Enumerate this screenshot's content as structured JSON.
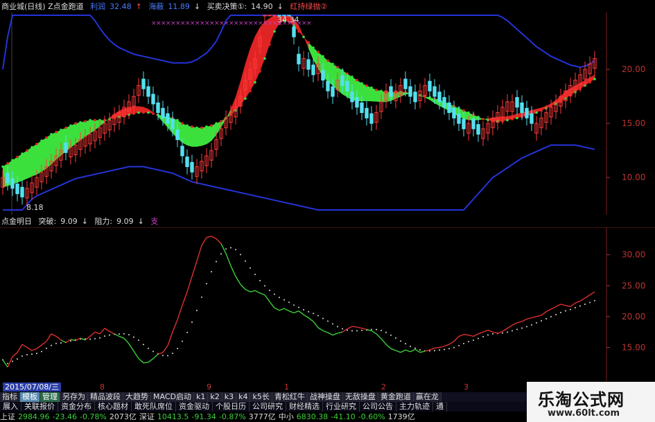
{
  "top_header": {
    "title": "商业城(日线) Z点金跑道",
    "profit_label": "利润",
    "profit_value": "32.48",
    "price_label": "海蔽",
    "price_value": "11.89",
    "signal_label": "买卖决策①:",
    "signal_value": "14.90",
    "redgreen_label": "红持绿抛②"
  },
  "bottom_header": {
    "title": "点金明日",
    "break_label": "突破:",
    "break_value": "9.09",
    "resist_label": "阻力:",
    "resist_value": "9.09",
    "tag": "支"
  },
  "annotations": {
    "high": "34.34",
    "low": "8.18"
  },
  "date_label": "2015/07/08/三",
  "tabs_row1": [
    {
      "label": "指标",
      "style": ""
    },
    {
      "label": "模板",
      "style": "active"
    },
    {
      "label": "管理",
      "style": "active2"
    },
    {
      "label": "另存为",
      "style": ""
    },
    {
      "label": "精品波段",
      "style": ""
    },
    {
      "label": "大趋势",
      "style": ""
    },
    {
      "label": "MACD启动",
      "style": ""
    },
    {
      "label": "k1",
      "style": ""
    },
    {
      "label": "k2",
      "style": ""
    },
    {
      "label": "k3",
      "style": ""
    },
    {
      "label": "k4",
      "style": ""
    },
    {
      "label": "k5长",
      "style": ""
    },
    {
      "label": "青松红牛",
      "style": ""
    },
    {
      "label": "战神操盘",
      "style": ""
    },
    {
      "label": "无敌操盘",
      "style": ""
    },
    {
      "label": "黄金跑道",
      "style": ""
    },
    {
      "label": "赢在龙",
      "style": ""
    }
  ],
  "tabs_row2": [
    "展入",
    "关联报价",
    "资金分布",
    "核心题材",
    "敢死队席位",
    "资金驱动",
    "个股日历",
    "公司研究",
    "财经精选",
    "行业研究",
    "公司公告",
    "主力轨迹",
    "通"
  ],
  "ticker": [
    {
      "text": "上证",
      "color": "#ddd"
    },
    {
      "text": "2984.96",
      "color": "#3ad03a"
    },
    {
      "text": "-23.46",
      "color": "#3ad03a"
    },
    {
      "text": "-0.78%",
      "color": "#3ad03a"
    },
    {
      "text": "2073亿",
      "color": "#ddd"
    },
    {
      "text": "深证",
      "color": "#ddd"
    },
    {
      "text": "10413.5",
      "color": "#3ad03a"
    },
    {
      "text": "-91.34",
      "color": "#3ad03a"
    },
    {
      "text": "-0.87%",
      "color": "#3ad03a"
    },
    {
      "text": "3777亿",
      "color": "#ddd"
    },
    {
      "text": "中小",
      "color": "#ddd"
    },
    {
      "text": "6830.38",
      "color": "#3ad03a"
    },
    {
      "text": "-41.10",
      "color": "#3ad03a"
    },
    {
      "text": "-0.60%",
      "color": "#3ad03a"
    },
    {
      "text": "1739亿",
      "color": "#ddd"
    }
  ],
  "brand": {
    "title": "乐淘公式网",
    "url": "www.60lt.com"
  },
  "chart_data": [
    {
      "type": "line",
      "ylim": [
        7,
        25
      ],
      "yticks": [
        "20.00",
        "15.00",
        "10.00"
      ],
      "ytick_values": [
        20,
        15,
        10
      ],
      "xticks": [
        {
          "label": "8",
          "i": 20
        },
        {
          "label": "9",
          "i": 42
        },
        {
          "label": "1",
          "i": 58
        },
        {
          "label": "2",
          "i": 78
        },
        {
          "label": "3",
          "i": 95
        }
      ],
      "n": 123,
      "candles": [
        10,
        9.5,
        9,
        8.5,
        8.2,
        9,
        9.5,
        10,
        10.5,
        11,
        11.5,
        12,
        12.5,
        12.3,
        12.8,
        13,
        13.5,
        13.8,
        14,
        14.3,
        14.6,
        15,
        15.3,
        15.8,
        16,
        16.5,
        17,
        17.5,
        18.5,
        18.2,
        17.5,
        16.8,
        16,
        15.5,
        15,
        14.5,
        13.5,
        12,
        11,
        10.5,
        11,
        11.5,
        12,
        12.5,
        13.5,
        14.5,
        15.5,
        16,
        16.5,
        17.5,
        19,
        20,
        21,
        23,
        26,
        31,
        33.5,
        32,
        29,
        26,
        23,
        20.5,
        21,
        20,
        19.5,
        20.5,
        19,
        18,
        17.5,
        19,
        18.5,
        18,
        17,
        16.5,
        16,
        15.5,
        15,
        16,
        17,
        18,
        17.5,
        18,
        18.5,
        18.2,
        17.5,
        17,
        18,
        18.5,
        18,
        17.5,
        17,
        16.5,
        16,
        15.5,
        15,
        14.5,
        15,
        14.5,
        14,
        14.5,
        15,
        15.5,
        16,
        16.5,
        17,
        17,
        16.5,
        16,
        15.5,
        15,
        15,
        15.5,
        16,
        16.5,
        17,
        17.5,
        18,
        18.5,
        19,
        19.5,
        20,
        20.5,
        21
      ],
      "mid": [
        11,
        11.3,
        11.6,
        11.9,
        12.2,
        12.5,
        12.8,
        13.1,
        13.4,
        13.7,
        14,
        14.2,
        14.4,
        14.6,
        14.8,
        15,
        15.1,
        15.2,
        15.3,
        15.3,
        15.3,
        15.3,
        15.4,
        15.5,
        15.6,
        15.7,
        15.8,
        15.9,
        16,
        16,
        16,
        15.9,
        15.8,
        15.7,
        15.6,
        15.5,
        15.3,
        15,
        14.8,
        14.7,
        14.6,
        14.6,
        14.7,
        14.8,
        15,
        15.2,
        15.5,
        15.8,
        16.2,
        16.7,
        17.3,
        18,
        18.8,
        19.8,
        21,
        22.3,
        23.5,
        24.2,
        24.5,
        24.4,
        24,
        23.5,
        23,
        22.5,
        22,
        21.6,
        21.2,
        20.8,
        20.5,
        20.2,
        19.9,
        19.6,
        19.3,
        19,
        18.7,
        18.5,
        18.3,
        18.1,
        18,
        17.9,
        17.9,
        17.9,
        17.9,
        17.9,
        17.8,
        17.7,
        17.6,
        17.5,
        17.4,
        17.3,
        17.2,
        17,
        16.8,
        16.6,
        16.4,
        16.2,
        16,
        15.8,
        15.6,
        15.4,
        15.3,
        15.2,
        15.2,
        15.2,
        15.3,
        15.4,
        15.5,
        15.6,
        15.7,
        15.8,
        16,
        16.2,
        16.4,
        16.6,
        16.8,
        17,
        17.3,
        17.6,
        17.9,
        18.2,
        18.5,
        18.8,
        19.1
      ],
      "upper": [
        20,
        23,
        26,
        28,
        29.5,
        30,
        30.3,
        30.5,
        30.4,
        30.2,
        30,
        29.6,
        29.2,
        28.7,
        28.2,
        27.5,
        26.8,
        26,
        25.2,
        24.5,
        23.8,
        23.2,
        22.7,
        22.3,
        22,
        21.8,
        21.6,
        21.4,
        21.3,
        21.2,
        21.1,
        21,
        20.9,
        20.8,
        20.7,
        20.6,
        20.6,
        20.6,
        20.6,
        20.7,
        20.9,
        21.2,
        21.5,
        22,
        22.6,
        23.5,
        24.5,
        25.8,
        27.5,
        29.5,
        31.5,
        33.5,
        35,
        35.8,
        36,
        36,
        36,
        36,
        35.8,
        35.6,
        35.4,
        35.2,
        35,
        34.8,
        34.6,
        34.4,
        34.2,
        34,
        33.8,
        33.6,
        33.4,
        33.2,
        33,
        32.8,
        32.6,
        32.4,
        32.2,
        32,
        31.8,
        31.6,
        31.4,
        31.2,
        31,
        30.8,
        30.5,
        30.2,
        29.9,
        29.6,
        29.3,
        29,
        28.7,
        28.4,
        28.1,
        27.8,
        27.5,
        27.2,
        26.9,
        26.6,
        26.3,
        26,
        25.7,
        25.4,
        25.1,
        24.8,
        24.5,
        24.1,
        23.7,
        23.3,
        22.9,
        22.5,
        22.1,
        21.8,
        21.5,
        21.2,
        21,
        20.8,
        20.6,
        20.4,
        20.3,
        20.2,
        20.3,
        20.5,
        20.8
      ],
      "lower": [
        5,
        5.5,
        6,
        6.5,
        7,
        7.5,
        8,
        8.3,
        8.5,
        8.7,
        8.9,
        9.1,
        9.3,
        9.5,
        9.7,
        9.9,
        10,
        10.1,
        10.2,
        10.3,
        10.4,
        10.5,
        10.6,
        10.7,
        10.8,
        10.9,
        11,
        11,
        11,
        11,
        10.9,
        10.8,
        10.7,
        10.6,
        10.5,
        10.4,
        10.2,
        10,
        9.8,
        9.6,
        9.5,
        9.4,
        9.3,
        9.2,
        9.1,
        9,
        8.9,
        8.8,
        8.7,
        8.6,
        8.5,
        8.4,
        8.3,
        8.2,
        8.1,
        8,
        7.9,
        7.8,
        7.7,
        7.6,
        7.5,
        7.4,
        7.3,
        7.2,
        7.1,
        7,
        6.9,
        6.8,
        6.7,
        6.6,
        6.5,
        6.4,
        6.3,
        6.2,
        6.1,
        6,
        6,
        6,
        6,
        6,
        6,
        6,
        6,
        6,
        6,
        6,
        6,
        6,
        6.1,
        6.2,
        6.3,
        6.4,
        6.5,
        6.6,
        6.8,
        7,
        7.5,
        8,
        8.5,
        9,
        9.5,
        10,
        10.3,
        10.6,
        10.9,
        11.2,
        11.5,
        11.8,
        12,
        12.2,
        12.4,
        12.6,
        12.8,
        13,
        13,
        13,
        13,
        13,
        13,
        12.9,
        12.8,
        12.7,
        12.6
      ]
    },
    {
      "type": "line",
      "ylim": [
        10,
        34
      ],
      "yticks": [
        "30.00",
        "25.00",
        "20.00",
        "15.00"
      ],
      "ytick_values": [
        30,
        25,
        20,
        15
      ],
      "n": 123,
      "series": [
        {
          "values": [
            13,
            11.8,
            13.5,
            14.2,
            15.5,
            15,
            14.5,
            14.8,
            15.4,
            16,
            17.2,
            16.8,
            16.2,
            15.8,
            16.3,
            16.1,
            16.5,
            16.2,
            16.8,
            17.5,
            17.2,
            18.1,
            17.6,
            17.2,
            16.8,
            16.5,
            15.6,
            14.4,
            13.2,
            12.5,
            12.6,
            13.2,
            13.9,
            14.2,
            15.3,
            17.5,
            19.5,
            21.8,
            24,
            26.5,
            29,
            31.5,
            32.8,
            33,
            32.6,
            31.8,
            30.2,
            28.2,
            26.5,
            25.2,
            24.4,
            24,
            24.2,
            23.8,
            23.5,
            22.4,
            21.4,
            21,
            21.3,
            20.9,
            20.6,
            20.9,
            20.3,
            19.8,
            19.2,
            18.2,
            17.7,
            17.4,
            17,
            17.3,
            17.5,
            18,
            18.4,
            18.3,
            18.1,
            17.9,
            17.7,
            17.2,
            16.4,
            15.5,
            14.8,
            14.5,
            14.2,
            14.6,
            14.3,
            14.7,
            14.2,
            14.4,
            14.6,
            14.9,
            15,
            15.2,
            15.5,
            16,
            16.8,
            17.1,
            17,
            16.8,
            17.2,
            17.5,
            17.8,
            17.5,
            17.3,
            17.6,
            18.1,
            18.6,
            19,
            19.2,
            19.6,
            19.8,
            20,
            20.2,
            20.8,
            21.2,
            21.6,
            22,
            21.8,
            21.6,
            22.2,
            22.5,
            23,
            23.5,
            24
          ]
        }
      ]
    }
  ]
}
